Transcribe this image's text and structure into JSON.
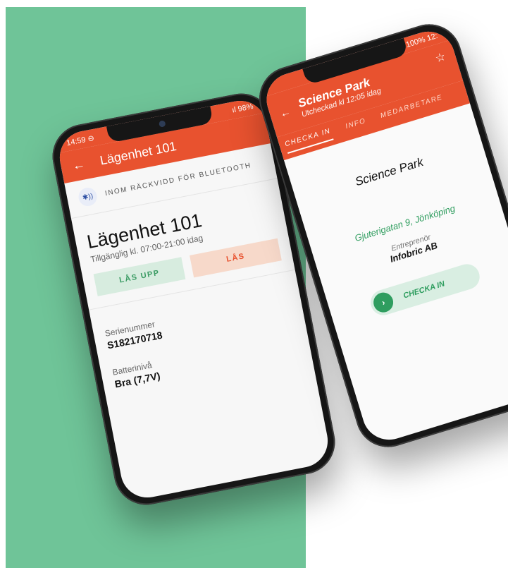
{
  "phone1": {
    "status": {
      "time": "14:59",
      "alarm_icon": "⊖",
      "signal": "ıl",
      "battery": "98%"
    },
    "app_bar": {
      "back_icon": "←",
      "title": "Lägenhet 101"
    },
    "bluetooth": {
      "icon": "bluetooth-icon",
      "icon_glyph": "✱))",
      "label": "INOM RÄCKVIDD FÖR BLUETOOTH"
    },
    "lock": {
      "name": "Lägenhet 101",
      "availability": "Tillgänglig kl. 07:00-21:00 idag"
    },
    "buttons": {
      "unlock": "LÅS UPP",
      "lock": "LÅS"
    },
    "details": [
      {
        "label": "Serienummer",
        "value": "S182170718"
      },
      {
        "label": "Batterinivå",
        "value": "Bra (7,7V)"
      }
    ]
  },
  "phone2": {
    "status": {
      "battery": "100%",
      "time": "12:"
    },
    "app_bar": {
      "back_icon": "←",
      "title": "Science Park",
      "subtitle": "Utcheckad kl 12:05 idag",
      "star_icon": "☆"
    },
    "tabs": [
      "CHECKA IN",
      "INFO",
      "MEDARBETARE"
    ],
    "place": "Science Park",
    "address": "Gjuterigatan 9, Jönköping",
    "role_label": "Entreprenör",
    "company": "Infobric AB",
    "checkin": {
      "knob_icon": "›",
      "label": "CHECKA IN"
    }
  },
  "colors": {
    "accent": "#e8522f",
    "green": "#2e9d5e",
    "panel": "#6fc498"
  }
}
